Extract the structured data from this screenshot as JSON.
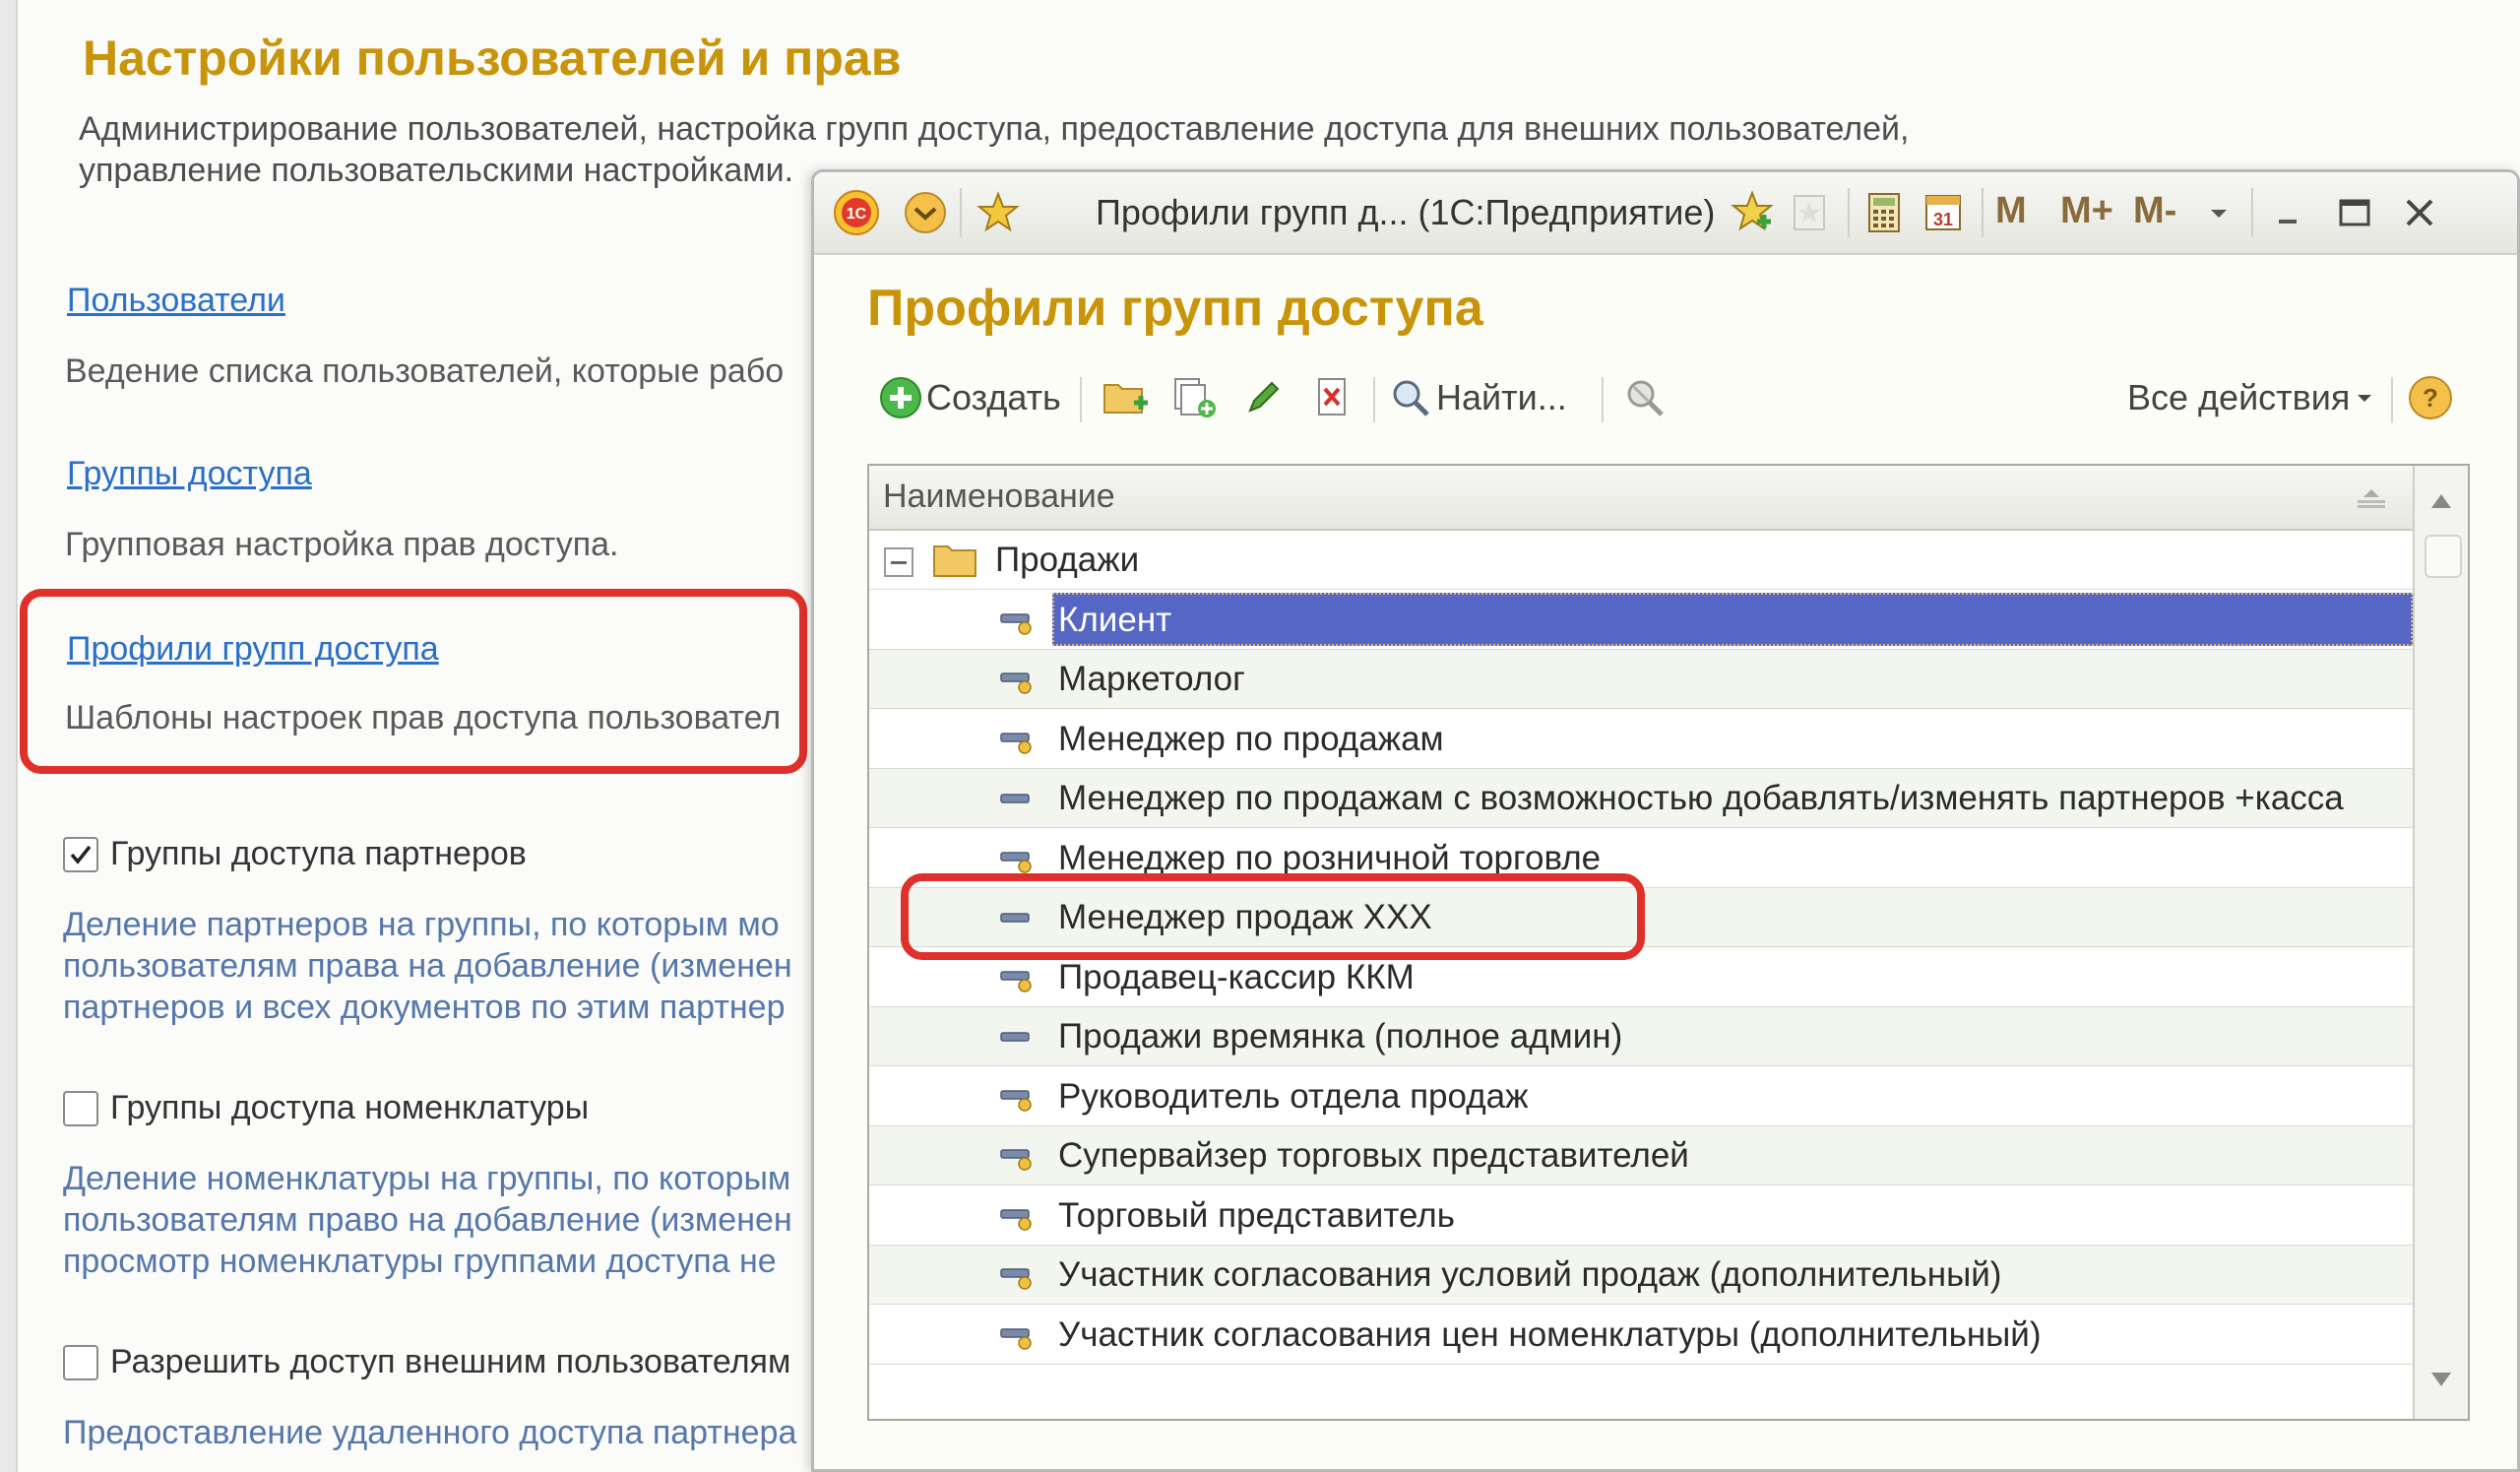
{
  "settings_panel": {
    "title": "Настройки пользователей и прав",
    "description_line1": "Администрирование пользователей, настройка групп доступа, предоставление доступа для внешних пользователей,",
    "description_line2": "управление пользовательскими настройками.",
    "sections": [
      {
        "link": "Пользователи",
        "text": "Ведение списка пользователей, которые рабо"
      },
      {
        "link": "Группы доступа",
        "text": "Групповая настройка прав доступа."
      },
      {
        "link": "Профили групп доступа",
        "text": "Шаблоны настроек прав доступа пользовател"
      }
    ],
    "checks": [
      {
        "label": "Группы доступа партнеров",
        "checked": true,
        "lines": [
          "Деление партнеров на группы, по которым мо",
          "пользователям права на добавление (изменен",
          "партнеров и всех документов по этим партнер"
        ]
      },
      {
        "label": "Группы доступа номенклатуры",
        "checked": false,
        "lines": [
          "Деление номенклатуры на группы, по которым",
          "пользователям право на добавление (изменен",
          "просмотр номенклатуры группами доступа не"
        ]
      },
      {
        "label": "Разрешить доступ внешним пользователям",
        "checked": false,
        "lines": [
          "Предоставление удаленного доступа партнера"
        ]
      }
    ]
  },
  "window": {
    "titlebar": {
      "title": "Профили групп д...  (1С:Предприятие)",
      "m": "M",
      "m_plus": "M+",
      "m_minus": "M-",
      "calendar_day": "31"
    },
    "heading": "Профили групп доступа",
    "toolbar": {
      "create": "Создать",
      "find": "Найти...",
      "all_actions": "Все действия",
      "help": "?"
    },
    "table": {
      "column_header": "Наименование",
      "group": "Продажи",
      "rows": [
        {
          "name": "Клиент",
          "icon": "profile-icon",
          "selected": true
        },
        {
          "name": "Маркетолог",
          "icon": "profile-icon"
        },
        {
          "name": "Менеджер по продажам",
          "icon": "profile-icon"
        },
        {
          "name": "Менеджер по продажам с возможностью добавлять/изменять партнеров +касса",
          "icon": "profile-plain-icon"
        },
        {
          "name": "Менеджер по розничной торговле",
          "icon": "profile-icon"
        },
        {
          "name": "Менеджер продаж ХХХ",
          "icon": "profile-plain-icon"
        },
        {
          "name": "Продавец-кассир ККМ",
          "icon": "profile-icon"
        },
        {
          "name": "Продажи времянка (полное админ)",
          "icon": "profile-plain-icon"
        },
        {
          "name": "Руководитель отдела продаж",
          "icon": "profile-icon"
        },
        {
          "name": "Супервайзер торговых представителей",
          "icon": "profile-icon"
        },
        {
          "name": "Торговый представитель",
          "icon": "profile-icon"
        },
        {
          "name": "Участник согласования условий продаж (дополнительный)",
          "icon": "profile-icon"
        },
        {
          "name": "Участник согласования цен номенклатуры (дополнительный)",
          "icon": "profile-icon"
        }
      ]
    }
  },
  "colors": {
    "accent_title": "#c8940a",
    "link": "#2a6fc8",
    "highlight": "#e0302a",
    "selection": "#5566c4"
  }
}
